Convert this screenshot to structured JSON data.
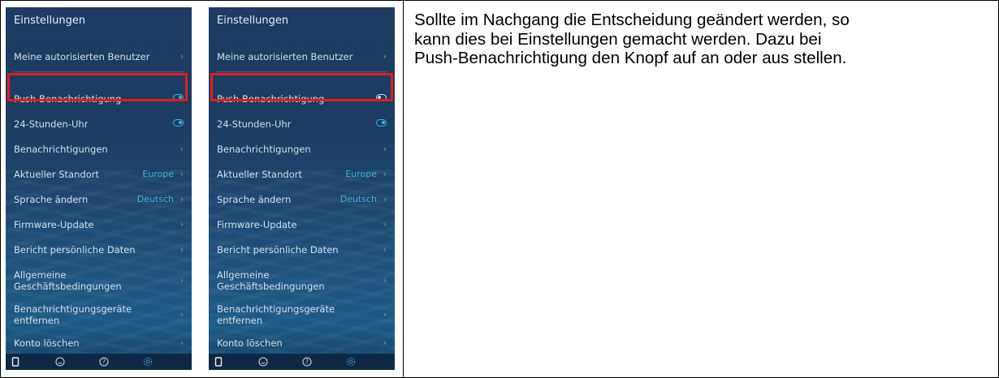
{
  "phones": [
    {
      "title": "Einstellungen",
      "items": [
        {
          "label": "Meine autorisierten Benutzer"
        },
        {
          "label": "Push-Benachrichtigung",
          "toggle": "on"
        },
        {
          "label": "24-Stunden-Uhr",
          "toggle": "on"
        },
        {
          "label": "Benachrichtigungen"
        },
        {
          "label": "Aktueller Standort",
          "value": "Europe"
        },
        {
          "label": "Sprache ändern",
          "value": "Deutsch"
        },
        {
          "label": "Firmware-Update"
        },
        {
          "label": "Bericht persönliche Daten"
        },
        {
          "label_lines": [
            "Allgemeine",
            "Geschäftsbedingungen"
          ]
        },
        {
          "label_lines": [
            "Benachrichtigungsgeräte",
            "entfernen"
          ]
        },
        {
          "label": "Konto löschen"
        }
      ]
    },
    {
      "title": "Einstellungen",
      "items": [
        {
          "label": "Meine autorisierten Benutzer"
        },
        {
          "label": "Push-Benachrichtigung",
          "toggle": "off"
        },
        {
          "label": "24-Stunden-Uhr",
          "toggle": "on"
        },
        {
          "label": "Benachrichtigungen"
        },
        {
          "label": "Aktueller Standort",
          "value": "Europe"
        },
        {
          "label": "Sprache ändern",
          "value": "Deutsch"
        },
        {
          "label": "Firmware-Update"
        },
        {
          "label": "Bericht persönliche Daten"
        },
        {
          "label_lines": [
            "Allgemeine",
            "Geschäftsbedingungen"
          ]
        },
        {
          "label_lines": [
            "Benachrichtigungsgeräte",
            "entfernen"
          ]
        },
        {
          "label": "Konto löschen"
        }
      ]
    }
  ],
  "tabbar": [
    "device-icon",
    "face-icon",
    "help-icon",
    "gear-icon"
  ],
  "chevron": "›",
  "colors": {
    "highlight": "#e31b1b",
    "accent": "#35b4e0"
  },
  "description_lines": [
    "Sollte im Nachgang die Entscheidung geändert werden, so",
    "kann dies bei Einstellungen gemacht werden. Dazu bei",
    "Push-Benachrichtigung den Knopf auf an oder aus stellen."
  ]
}
